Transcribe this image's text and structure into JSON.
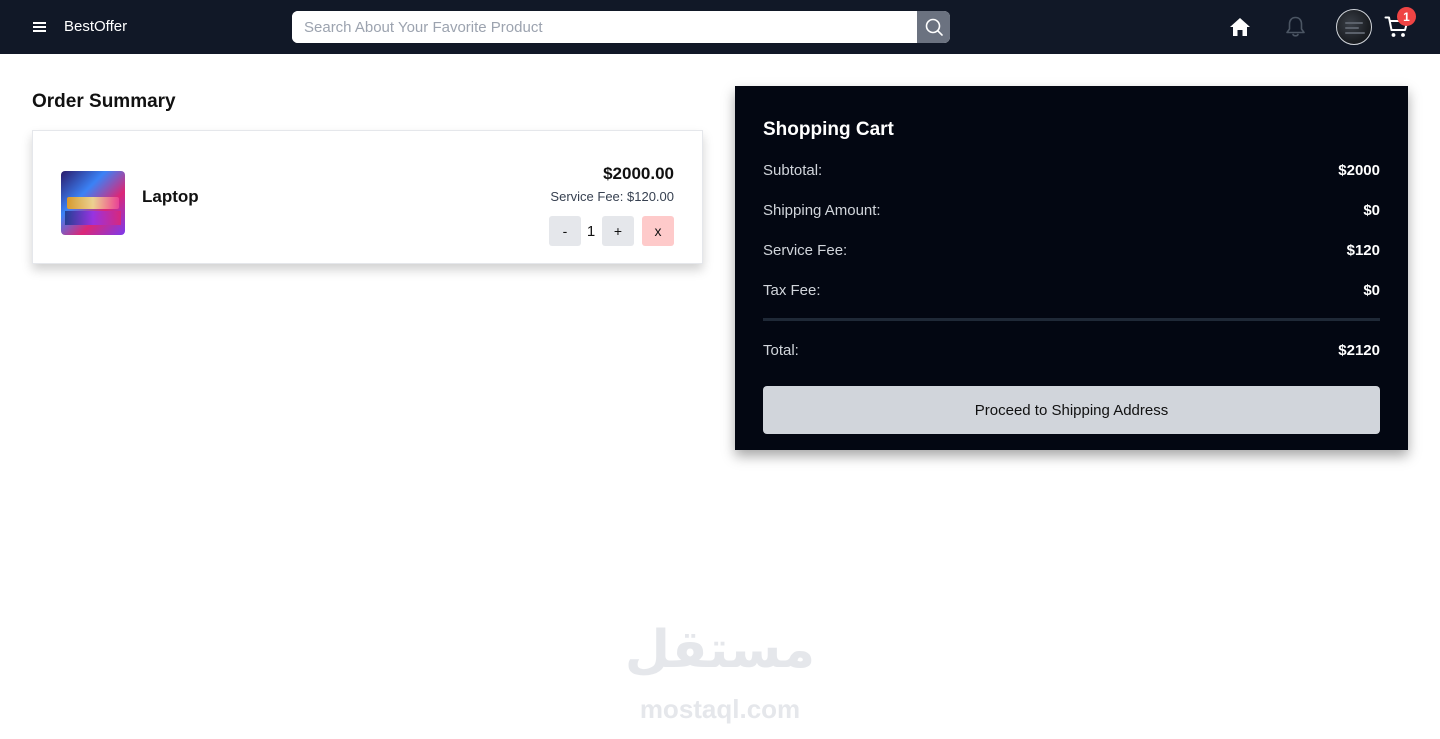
{
  "navbar": {
    "brand": "BestOffer",
    "search_placeholder": "Search About Your Favorite Product",
    "cart_count": "1",
    "icons": {
      "menu": "hamburger-icon",
      "search": "search-icon",
      "home": "home-icon",
      "notifications": "bell-icon",
      "cart": "cart-icon"
    }
  },
  "order": {
    "title": "Order Summary",
    "items": [
      {
        "name": "Laptop",
        "price": "$2000.00",
        "service_fee": "Service Fee: $120.00",
        "quantity": "1",
        "minus_label": "-",
        "plus_label": "+",
        "remove_label": "x"
      }
    ]
  },
  "cart": {
    "title": "Shopping Cart",
    "rows": [
      {
        "label": "Subtotal:",
        "value": "$2000"
      },
      {
        "label": "Shipping Amount:",
        "value": "$0"
      },
      {
        "label": "Service Fee:",
        "value": "$120"
      },
      {
        "label": "Tax Fee:",
        "value": "$0"
      }
    ],
    "total": {
      "label": "Total:",
      "value": "$2120"
    },
    "proceed_label": "Proceed to Shipping Address"
  },
  "watermark": {
    "arabic": "مستقل",
    "latin": "mostaql.com"
  },
  "colors": {
    "navbar_bg": "#111827",
    "cart_panel_bg": "#030712",
    "badge": "#ef4444",
    "remove_button": "#fecaca",
    "proceed_button": "#d1d5db"
  }
}
